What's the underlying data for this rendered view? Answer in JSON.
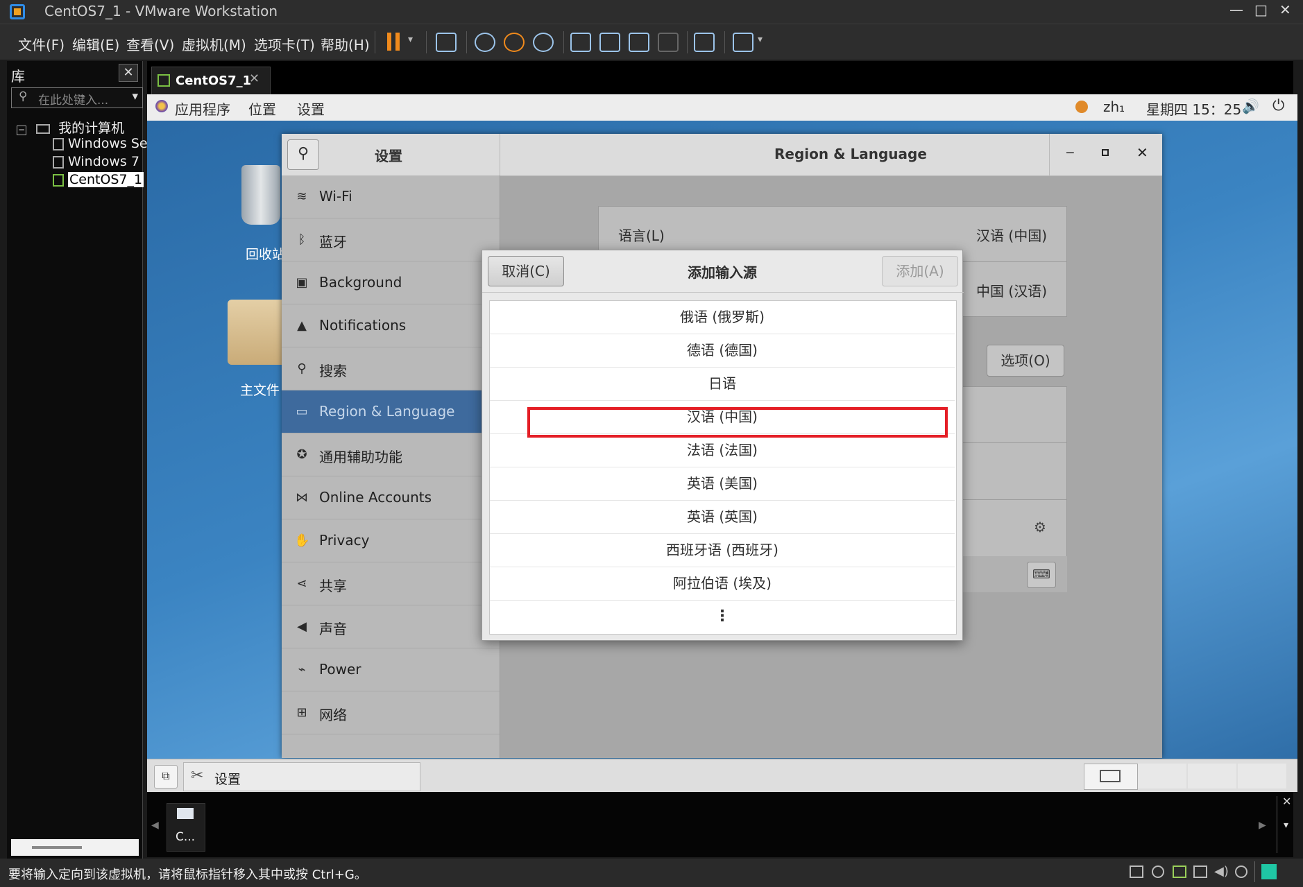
{
  "window": {
    "title": "CentOS7_1 - VMware Workstation",
    "controls": [
      "—",
      "□",
      "✕"
    ]
  },
  "menubar": {
    "items": [
      "文件(F)",
      "编辑(E)",
      "查看(V)",
      "虚拟机(M)",
      "选项卡(T)",
      "帮助(H)"
    ]
  },
  "library": {
    "title": "库",
    "search_placeholder": "在此处键入...",
    "root": "我的计算机",
    "vms": [
      "Windows Se",
      "Windows 7",
      "CentOS7_1"
    ]
  },
  "tab": {
    "label": "CentOS7_1"
  },
  "gnome": {
    "menus": [
      "应用程序",
      "位置",
      "设置"
    ],
    "input_method": "zh₁",
    "clock": "星期四 15：25"
  },
  "desktop": {
    "icons": [
      "回收站",
      "主文件"
    ]
  },
  "settings": {
    "sidebar_title": "设置",
    "panel_title": "Region & Language",
    "sidebar_items": [
      {
        "label": "Wi-Fi",
        "icon": "wifi-icon"
      },
      {
        "label": "蓝牙",
        "icon": "bluetooth-icon"
      },
      {
        "label": "Background",
        "icon": "background-icon"
      },
      {
        "label": "Notifications",
        "icon": "bell-icon"
      },
      {
        "label": "搜索",
        "icon": "search-icon"
      },
      {
        "label": "Region & Language",
        "icon": "region-icon",
        "active": true
      },
      {
        "label": "通用辅助功能",
        "icon": "accessibility-icon"
      },
      {
        "label": "Online Accounts",
        "icon": "online-accounts-icon"
      },
      {
        "label": "Privacy",
        "icon": "hand-icon"
      },
      {
        "label": "共享",
        "icon": "share-icon"
      },
      {
        "label": "声音",
        "icon": "speaker-icon"
      },
      {
        "label": "Power",
        "icon": "power-icon"
      },
      {
        "label": "网络",
        "icon": "network-icon"
      }
    ],
    "language_label": "语言(L)",
    "language_value": "汉语 (中国)",
    "formats_value": "中国 (汉语)",
    "options_button": "选项(O)"
  },
  "dialog": {
    "title": "添加输入源",
    "cancel": "取消(C)",
    "add": "添加(A)",
    "languages": [
      "俄语 (俄罗斯)",
      "德语 (德国)",
      "日语",
      "汉语 (中国)",
      "法语 (法国)",
      "英语 (美国)",
      "英语 (英国)",
      "西班牙语 (西班牙)",
      "阿拉伯语 (埃及)"
    ],
    "more": "⋮"
  },
  "taskbar": {
    "app": "设置"
  },
  "thumbnail": {
    "label": "C..."
  },
  "status": {
    "message": "要将输入定向到该虚拟机，请将鼠标指针移入其中或按 Ctrl+G。"
  },
  "colors": {
    "accent": "#3e6a9d",
    "highlight": "#e41e26"
  }
}
